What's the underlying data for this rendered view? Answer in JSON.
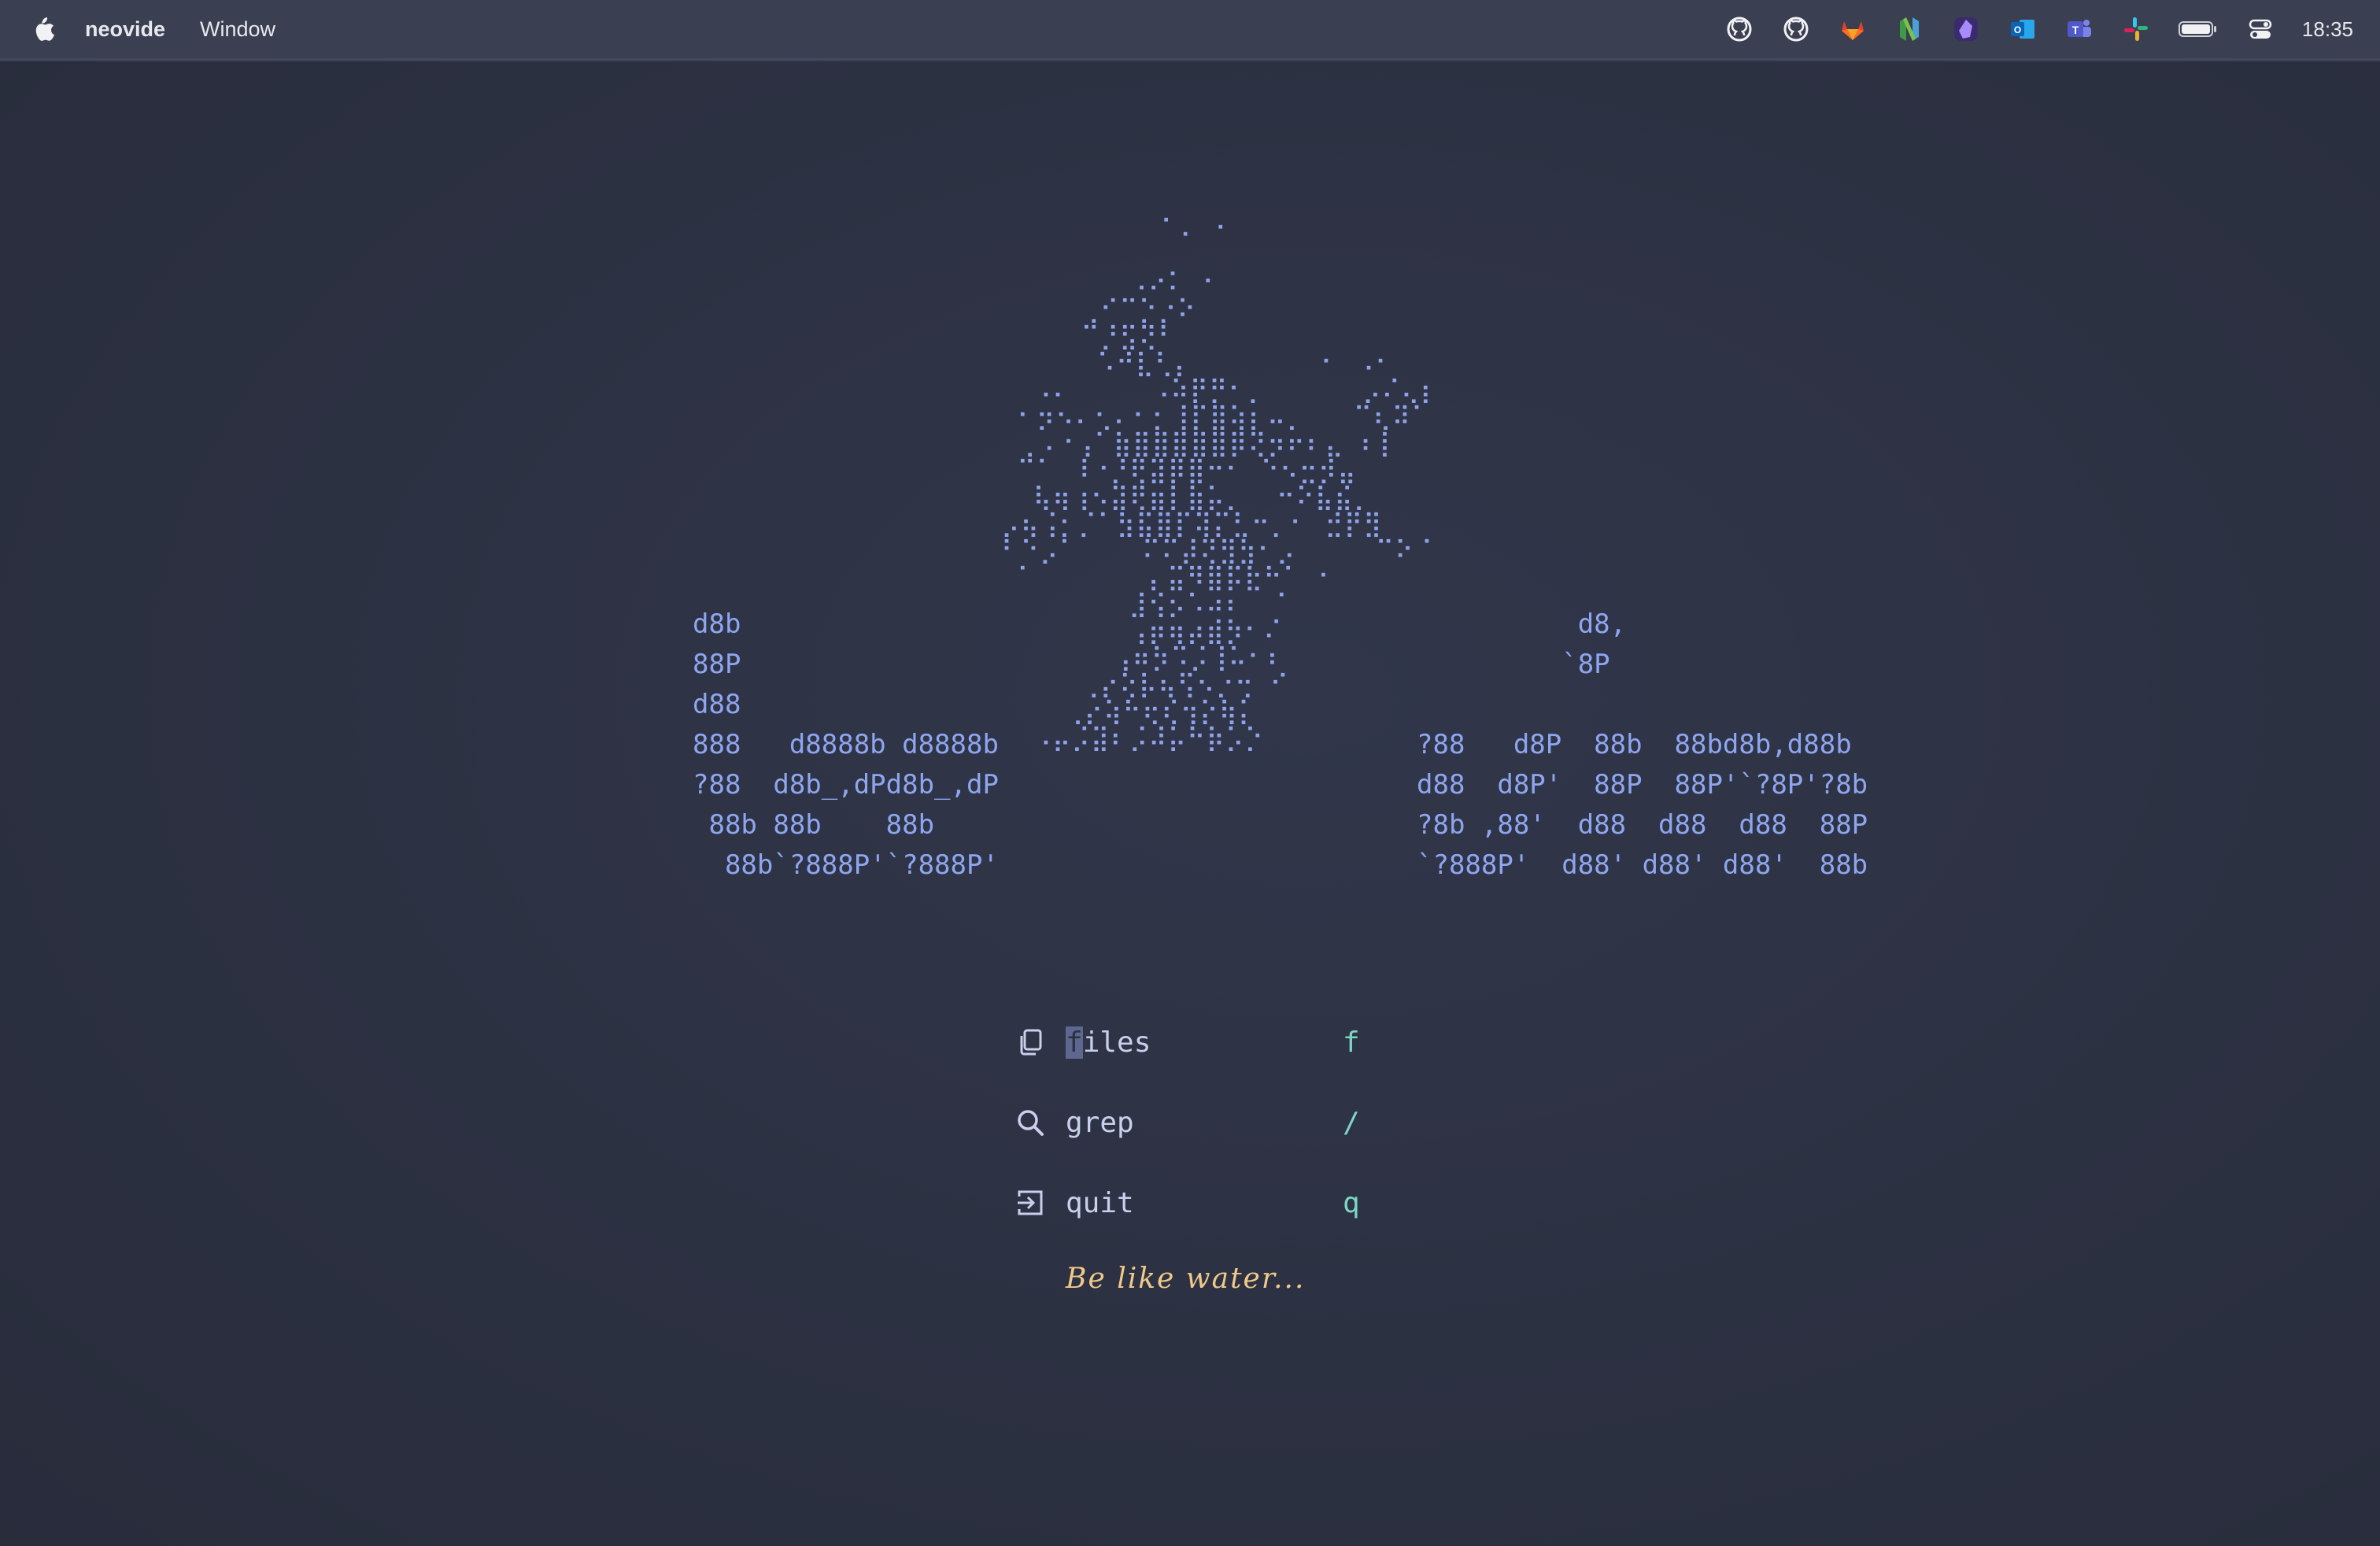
{
  "menubar": {
    "app_name": "neovide",
    "menu_items": [
      "Window"
    ],
    "tray_icons": [
      "github-icon",
      "github-desktop-icon",
      "gitlab-icon",
      "neovim-icon",
      "obsidian-icon",
      "outlook-icon",
      "teams-icon",
      "slack-icon",
      "battery-icon",
      "control-center-icon"
    ],
    "clock": "18:35"
  },
  "dashboard": {
    "logo_left": "d8b\n88P\nd88\n888   d8888b d8888b\n?88  d8b_,dPd8b_,dP\n 88b 88b    88b\n  88b`?888P'`?888P'",
    "logo_right": "          d8,\n         `8P\n\n?88   d8P  88b  88bd8b,d88b\nd88  d8P'  88P  88P'`?8P'?8b\n?8b ,88'  d88  d88  d88  88P\n`?888P'  d88' d88' d88'  88b",
    "figure": "          ⠁⠄ ⠂\n\n        ⠠⠔⠅ ⠂\n     ⢀⠊⠉⡑⡐⠕\n     ⠉⡘⣫⢝⠃\n      ⠡⠚⣇⢃⡄        ⠂ ⠠⠂\n  ⠠⠄     ⠠⠵⡟⡛⠂⡀      ⡠⠌⢄⡆\n ⠂⡲⠢⠄⢂⠄⠂⡂⢸⡏⣿⢵⡆⠤⡀   ⠉⢆⠽⠁\n ⢀⠠⠐⢠⠁⣷⣿⣿⣿⣿⣿⡿⢝⡲⠖⠆⣄ ⠆⡇\n ⠉⠁ ⠸⠐⡘⢟⣽⡿⣿⠒⠂ ⠑⠢⣒⡺⣤\n  ⢧⢶⢰⠢⣽⢟⣶⡇⣷⡥⡀  ⠒⠕⣧⣮⡀\n⡠⢦⢨⡂⡈⠁⣳⣯⣿⡏⢽⡍⣃⠒⡀⠂ ⣚⡟⣻\n⠃⠑⡠⠁    ⠍⠍⡼⢝⣻⣳⠂⡠     ⠉⠕⠈\n ⠁       ⡄⣭⠻⣿⡯⣗⠓⠁ ⠂\n        ⣸⢪⡢⠡⠴⠆  ⠁\n        ⢠⡶⢶⡴⣾⡳⠂⠌\n       ⢠⠶⡳⠩⡨⢸⠥⠂⠆\n     ⢀⡔⢕⡧⢦⢫⠢⡐⢒ ⠊\n    ⢀⡔⢵⠓⢖⢎⢲⡕⢷⡅\n  ⠠⡤⡨⣽⠆⡨⠼⡥⠓⡷⡡⡑",
    "items": [
      {
        "label": "files",
        "key": "f",
        "icon": "copy-icon"
      },
      {
        "label": "grep",
        "key": "/",
        "icon": "search-icon"
      },
      {
        "label": "quit",
        "key": "q",
        "icon": "exit-icon"
      }
    ],
    "footer": "Be like water..."
  },
  "colors": {
    "background": "#2c3142",
    "logo": "#8ea6f0",
    "key": "#7ed6c4",
    "footer": "#f0c98a",
    "menu_text": "#c8d0ec"
  }
}
